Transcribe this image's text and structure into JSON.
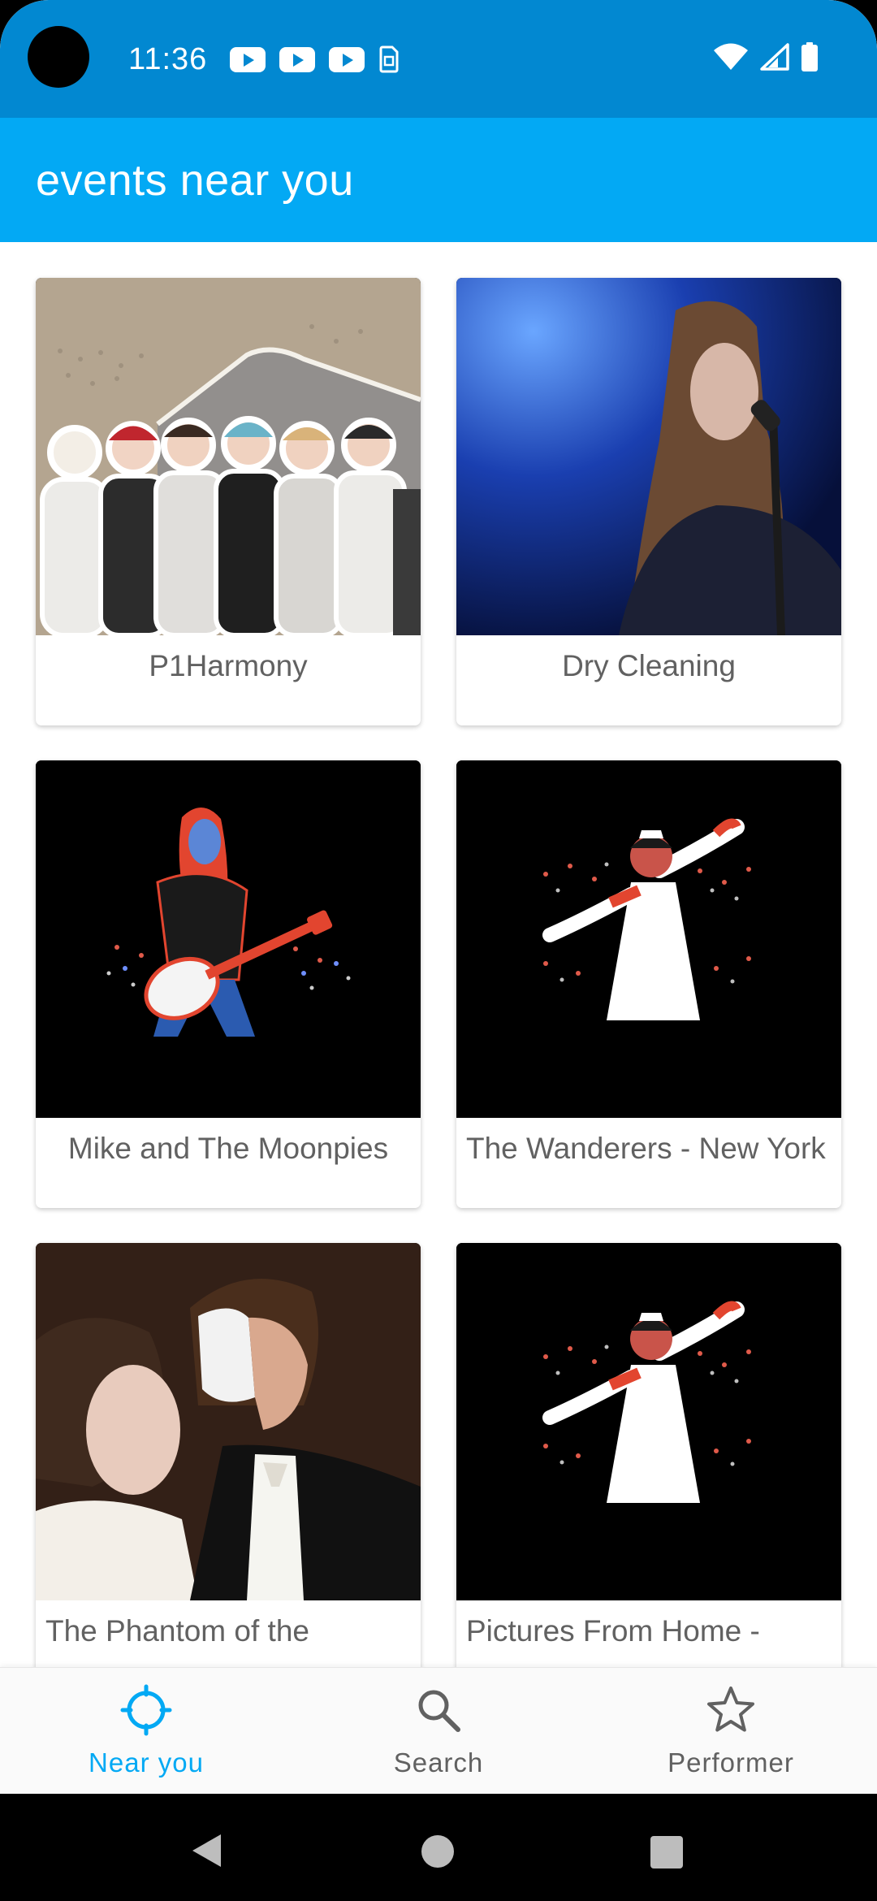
{
  "status_bar": {
    "time": "11:36",
    "notification_icons": [
      "youtube-icon",
      "youtube-icon",
      "youtube-icon",
      "sim-card-icon"
    ],
    "system_icons": [
      "wifi-icon",
      "signal-icon",
      "battery-icon"
    ]
  },
  "app_bar": {
    "title": "events near you"
  },
  "events": [
    {
      "title": "P1Harmony",
      "image": "group-photo"
    },
    {
      "title": "Dry Cleaning",
      "image": "singer-at-microphone"
    },
    {
      "title": "Mike and The Moonpies",
      "image": "guitarist-illustration"
    },
    {
      "title": "The Wanderers - New York",
      "image": "dancer-illustration"
    },
    {
      "title": "The Phantom of the",
      "image": "phantom-stage-photo"
    },
    {
      "title": "Pictures From Home -",
      "image": "dancer-illustration"
    }
  ],
  "bottom_nav": {
    "active": "near_you",
    "accent_color": "#03a9f4",
    "inactive_color": "#616161",
    "items": [
      {
        "label": "Near you",
        "icon": "crosshair-icon"
      },
      {
        "label": "Search",
        "icon": "search-icon"
      },
      {
        "label": "Performer",
        "icon": "star-icon"
      }
    ]
  },
  "colors": {
    "status_bar": "#0288d1",
    "app_bar": "#03a9f4"
  }
}
